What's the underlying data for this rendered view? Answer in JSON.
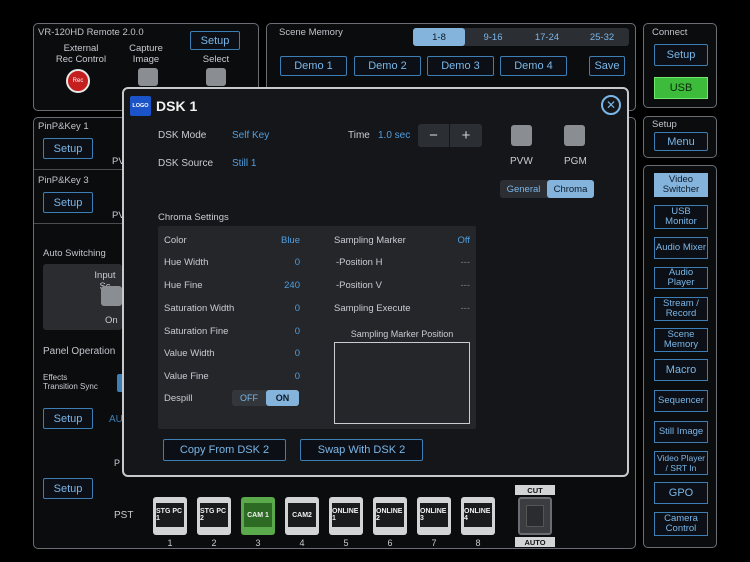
{
  "remote": {
    "title": "VR-120HD Remote 2.0.0",
    "setup_label": "Setup",
    "external_rec_label": "External\nRec Control",
    "rec_label": "Rec",
    "capture_label": "Capture\nImage",
    "select_label": "Select"
  },
  "scene_memory": {
    "title": "Scene Memory",
    "tabs": [
      "1-8",
      "9-16",
      "17-24",
      "25-32"
    ],
    "demos": [
      "Demo 1",
      "Demo 2",
      "Demo 3",
      "Demo 4"
    ],
    "save_label": "Save"
  },
  "connect": {
    "title": "Connect",
    "setup_label": "Setup",
    "usb_label": "USB"
  },
  "setup_panel": {
    "title": "Setup",
    "menu_label": "Menu"
  },
  "sidebar": {
    "items": [
      "Video\nSwitcher",
      "USB\nMonitor",
      "Audio Mixer",
      "Audio Player",
      "Stream /\nRecord",
      "Scene\nMemory",
      "Macro",
      "Sequencer",
      "Still Image",
      "Video Player\n/ SRT In",
      "GPO",
      "Camera\nControl"
    ]
  },
  "left": {
    "pinp1_title": "PinP&Key 1",
    "pinp3_title": "PinP&Key 3",
    "setup_label": "Setup",
    "pv_label": "PV",
    "auto_switching": "Auto Switching",
    "input_sc": "Input Sc",
    "on_label": "On",
    "panel_operation": "Panel Operation",
    "effects_sync": "Effects\nTransition Sync",
    "au_label": "AU",
    "p_label": "P",
    "pst_label": "PST"
  },
  "dsk": {
    "logo": "LOGO",
    "title": "DSK 1",
    "mode_label": "DSK Mode",
    "mode_value": "Self Key",
    "source_label": "DSK Source",
    "source_value": "Still 1",
    "time_label": "Time",
    "time_value": "1.0 sec",
    "minus": "−",
    "plus": "+",
    "pvw_label": "PVW",
    "pgm_label": "PGM",
    "tab_general": "General",
    "tab_chroma": "Chroma",
    "chroma_title": "Chroma Settings",
    "rows": [
      {
        "label": "Color",
        "value": "Blue"
      },
      {
        "label": "Hue Width",
        "value": "0"
      },
      {
        "label": "Hue Fine",
        "value": "240"
      },
      {
        "label": "Saturation Width",
        "value": "0"
      },
      {
        "label": "Saturation Fine",
        "value": "0"
      },
      {
        "label": "Value Width",
        "value": "0"
      },
      {
        "label": "Value Fine",
        "value": "0"
      }
    ],
    "despill_label": "Despill",
    "despill_off": "OFF",
    "despill_on": "ON",
    "sampling": [
      {
        "label": "Sampling Marker",
        "value": "Off"
      },
      {
        "label": "-Position H",
        "value": "---"
      },
      {
        "label": "-Position V",
        "value": "---"
      },
      {
        "label": "Sampling Execute",
        "value": "---"
      }
    ],
    "marker_position_label": "Sampling Marker Position",
    "copy_label": "Copy From DSK 2",
    "swap_label": "Swap With DSK 2"
  },
  "pst": {
    "buttons": [
      "STG PC 1",
      "STG PC 2",
      "CAM 1",
      "CAM2",
      "ONLINE 1",
      "ONLINE 2",
      "ONLINE 3",
      "ONLINE 4"
    ],
    "numbers": [
      "1",
      "2",
      "3",
      "4",
      "5",
      "6",
      "7",
      "8"
    ],
    "cut_label": "CUT",
    "auto_label": "AUTO"
  },
  "colors": {
    "accent": "#3d7fb4",
    "value_blue": "#4f9fe0",
    "usb_green": "#3dbb3a",
    "arrow_green": "#3fa63a"
  }
}
